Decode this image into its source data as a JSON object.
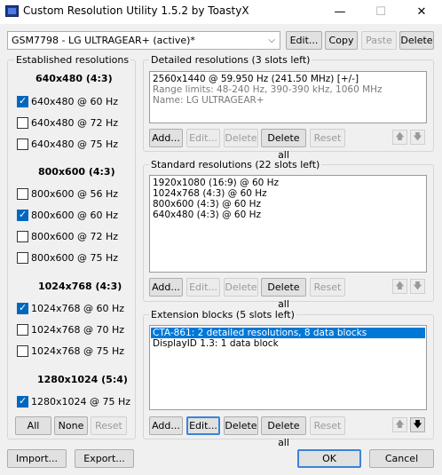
{
  "window": {
    "title": "Custom Resolution Utility 1.5.2 by ToastyX",
    "minimize": "—",
    "maximize": "☐",
    "close": "✕"
  },
  "top": {
    "monitor": "GSM7798 - LG ULTRAGEAR+ (active)*",
    "edit": "Edit...",
    "copy": "Copy",
    "paste": "Paste",
    "delete": "Delete"
  },
  "established": {
    "title": "Established resolutions",
    "sections": [
      {
        "title": "640x480 (4:3)",
        "items": [
          {
            "label": "640x480 @ 60 Hz",
            "checked": true
          },
          {
            "label": "640x480 @ 72 Hz",
            "checked": false
          },
          {
            "label": "640x480 @ 75 Hz",
            "checked": false
          }
        ]
      },
      {
        "title": "800x600 (4:3)",
        "items": [
          {
            "label": "800x600 @ 56 Hz",
            "checked": false
          },
          {
            "label": "800x600 @ 60 Hz",
            "checked": true
          },
          {
            "label": "800x600 @ 72 Hz",
            "checked": false
          },
          {
            "label": "800x600 @ 75 Hz",
            "checked": false
          }
        ]
      },
      {
        "title": "1024x768 (4:3)",
        "items": [
          {
            "label": "1024x768 @ 60 Hz",
            "checked": true
          },
          {
            "label": "1024x768 @ 70 Hz",
            "checked": false
          },
          {
            "label": "1024x768 @ 75 Hz",
            "checked": false
          }
        ]
      },
      {
        "title": "1280x1024 (5:4)",
        "items": [
          {
            "label": "1280x1024 @ 75 Hz",
            "checked": true
          }
        ]
      }
    ],
    "all": "All",
    "none": "None",
    "reset": "Reset"
  },
  "detailed": {
    "title": "Detailed resolutions (3 slots left)",
    "lines": [
      "2560x1440 @ 59.950 Hz (241.50 MHz) [+/-]",
      "Range limits: 48-240 Hz, 390-390 kHz, 1060 MHz",
      "Name: LG ULTRAGEAR+"
    ]
  },
  "standard": {
    "title": "Standard resolutions (22 slots left)",
    "lines": [
      "1920x1080 (16:9) @ 60 Hz",
      "1024x768 (4:3) @ 60 Hz",
      "800x600 (4:3) @ 60 Hz",
      "640x480 (4:3) @ 60 Hz"
    ]
  },
  "extension": {
    "title": "Extension blocks (5 slots left)",
    "lines": [
      "CTA-861: 2 detailed resolutions, 8 data blocks",
      "DisplayID 1.3: 1 data block"
    ]
  },
  "buttons": {
    "add": "Add...",
    "edit": "Edit...",
    "delete": "Delete",
    "delete_all": "Delete all",
    "reset": "Reset",
    "up": "🡅",
    "down": "🡇"
  },
  "bottom": {
    "import": "Import...",
    "export": "Export...",
    "ok": "OK",
    "cancel": "Cancel"
  }
}
